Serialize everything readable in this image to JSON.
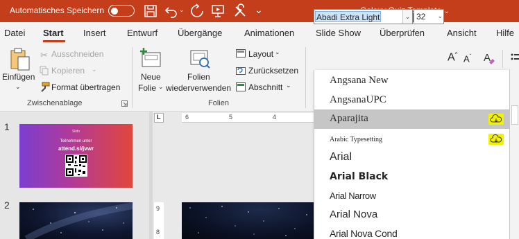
{
  "titlebar": {
    "autosave_label": "Automatisches Speichern",
    "autosave_state": "off",
    "document_title": "Galaxy Quiz Template",
    "document_title_chevron": "⌄",
    "icons": [
      "save-icon",
      "undo-icon",
      "redo-icon",
      "present-icon",
      "tools-icon",
      "more-icon"
    ]
  },
  "tabs": [
    "Datei",
    "Start",
    "Insert",
    "Entwurf",
    "Übergänge",
    "Animationen",
    "Slide Show",
    "Überprüfen",
    "Ansicht",
    "Hilfe"
  ],
  "active_tab": "Start",
  "clipboard": {
    "paste_label": "Einfügen",
    "paste_chevron": "⌄",
    "cut_label": "Ausschneiden",
    "copy_label": "Kopieren",
    "copy_chevron": "⌄",
    "format_painter_label": "Format übertragen",
    "group_label": "Zwischenablage"
  },
  "slides_group": {
    "new_slide_line1": "Neue",
    "new_slide_line2": "Folie",
    "new_slide_chevron": "⌄",
    "reuse_line1": "Folien",
    "reuse_line2": "wiederverwenden",
    "layout_label": "Layout",
    "layout_chevron": "⌄",
    "reset_label": "Zurücksetzen",
    "section_label": "Abschnitt",
    "section_chevron": "⌄",
    "group_label": "Folien"
  },
  "font": {
    "current_font": "Abadi Extra Light",
    "current_size": "32",
    "dropdown_arrow": "⌄",
    "grow_label": "A",
    "shrink_label": "A"
  },
  "font_list": [
    {
      "name": "Angsana New",
      "family": "serif",
      "size": 15,
      "cloud": false,
      "hover": false
    },
    {
      "name": "AngsanaUPC",
      "family": "serif",
      "size": 15,
      "cloud": false,
      "hover": false
    },
    {
      "name": "Aparajita",
      "family": "serif",
      "size": 15,
      "cloud": true,
      "hover": true
    },
    {
      "name": "Arabic Typesetting",
      "family": "serif",
      "size": 10,
      "cloud": true,
      "hover": false
    },
    {
      "name": "Arial",
      "family": "sans",
      "size": 16,
      "cloud": false,
      "hover": false
    },
    {
      "name": "Arial Black",
      "family": "sans-black",
      "size": 14,
      "cloud": false,
      "hover": false
    },
    {
      "name": "Arial Narrow",
      "family": "sans-narrow",
      "size": 13,
      "cloud": false,
      "hover": false
    },
    {
      "name": "Arial Nova",
      "family": "sans",
      "size": 15,
      "cloud": false,
      "hover": false
    },
    {
      "name": "Arial Nova Cond",
      "family": "sans-narrow",
      "size": 14,
      "cloud": false,
      "hover": false
    }
  ],
  "slides": {
    "slide1_number": "1",
    "slide1_logo": "Slido",
    "slide1_line1": "Teilnehmen unter",
    "slide1_line2": "attend.sl/jvwr",
    "slide2_number": "2"
  },
  "ruler": {
    "corner": "L",
    "h_numbers": [
      "6",
      "5",
      "4"
    ],
    "v_numbers": [
      "9",
      "8"
    ]
  },
  "colors": {
    "accent": "#c43e1c",
    "highlight": "#f2f200"
  }
}
